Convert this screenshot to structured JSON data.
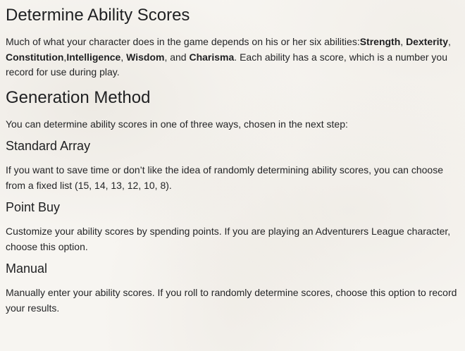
{
  "intro": {
    "title": "Determine Ability Scores",
    "text_before": "Much of what your character does in the game depends on his or her six abilities:",
    "abilities": [
      "Strength",
      "Dexterity",
      "Constitution",
      "Intelligence",
      "Wisdom",
      "Charisma"
    ],
    "sep_1": ", ",
    "sep_2": ", ",
    "sep_3": ",",
    "sep_4": ", ",
    "sep_5": ", and ",
    "text_after": ". Each ability has a score, which is a number you record for use during play."
  },
  "generation": {
    "title": "Generation Method",
    "text": "You can determine ability scores in one of three ways, chosen in the next step:"
  },
  "methods": [
    {
      "name": "Standard Array",
      "description": "If you want to save time or don’t like the idea of randomly determining ability scores, you can choose from a fixed list (15, 14, 13, 12, 10, 8)."
    },
    {
      "name": "Point Buy",
      "description": "Customize your ability scores by spending points. If you are playing an Adventurers League character, choose this option."
    },
    {
      "name": "Manual",
      "description": "Manually enter your ability scores. If you roll to randomly determine scores, choose this option to record your results."
    }
  ]
}
